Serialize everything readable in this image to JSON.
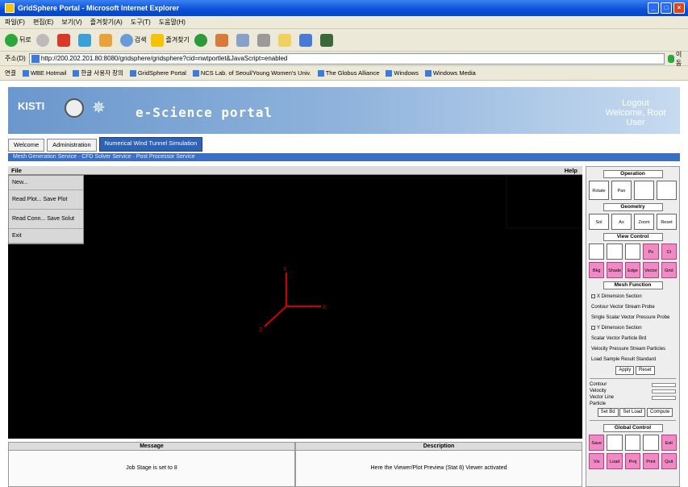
{
  "window": {
    "title": "GridSphere Portal - Microsoft Internet Explorer"
  },
  "menubar": [
    "파일(F)",
    "편집(E)",
    "보기(V)",
    "즐겨찾기(A)",
    "도구(T)",
    "도움말(H)"
  ],
  "toolbar": {
    "back": "뒤로",
    "search": "검색",
    "favorites": "즐겨찾기"
  },
  "address": {
    "label": "주소(D)",
    "url": "http://200.202.201.80:8080/gridsphere/gridsphere?cid=nwtportlet&JavaScript=enabled",
    "go": "이동"
  },
  "links": {
    "label": "연결",
    "items": [
      "WBE Hotmail",
      "한글 사용자 창의",
      "GridSphere Portal",
      "NCS Lab. of Seoul/Young Women's Univ.",
      "The Globus Alliance",
      "Windows",
      "Windows Media"
    ]
  },
  "banner": {
    "kisti": "KISTI",
    "title": "e-Science portal",
    "logout": "Logout",
    "welcome": "Welcome, Root User"
  },
  "tabs": [
    "Welcome",
    "Administration",
    "Numerical Wind Tunnel Simulation"
  ],
  "subbar": "Mesh Generation Service · CFD Solver Service · Post Processor Service",
  "viewer": {
    "file_label": "File",
    "help_label": "Help",
    "file_menu": [
      "New...",
      "Read Plot... Save Plot",
      "Read Conn... Save Solut",
      "Exit"
    ],
    "axes": {
      "y": "Y",
      "x": "X",
      "z": "Z"
    }
  },
  "bottom": {
    "left": {
      "title": "Message",
      "body": "Job Stage is set to 8"
    },
    "right": {
      "title": "Description",
      "body": "Here the Viewer/Plot Preview (Stat 8) Viewer activated"
    }
  },
  "rpanel": {
    "operation": "Operation",
    "operation_btns": [
      "Rotate",
      "Pan",
      "",
      ""
    ],
    "geometry": "Geometry",
    "geometry_btns": [
      "Sol",
      "Ax",
      "Zoom",
      "Reset"
    ],
    "view_control": "View Control",
    "view_btns": [
      "",
      "",
      "",
      "Ps",
      "Ct"
    ],
    "view_btns2": [
      "Bkg",
      "Shade",
      "Edge Line",
      "Vector",
      "Grid"
    ],
    "mesh_section": "Mesh Function",
    "options": [
      "X Dimension Section",
      "Contour Vector Stream Probe",
      "Single Scalar Vector Pressure Probe",
      "Y Dimension Section",
      "Scalar Vector Particle Brd",
      "Velocity Pressure Stream Particles",
      "Load Sample Result Standard"
    ],
    "apply": "Apply",
    "reset": "Reset",
    "legend": [
      "Contour",
      "Velocity",
      "Vector Line",
      "Particle"
    ],
    "btn_row_labels": [
      "Set Bd",
      "Set Load",
      "Compute"
    ],
    "global": "Global Control",
    "global_btns": [
      "Save",
      "",
      "",
      "",
      "Exit"
    ],
    "global_btns2": [
      "Vis",
      "Load",
      "Proj",
      "Print",
      "Quit"
    ]
  },
  "colors": {
    "titlebar": "#0a4fd8",
    "banner": "#4a7fc0",
    "active_tab": "#2d62b4",
    "pink": "#f08ac4",
    "axis": "#d00000"
  }
}
